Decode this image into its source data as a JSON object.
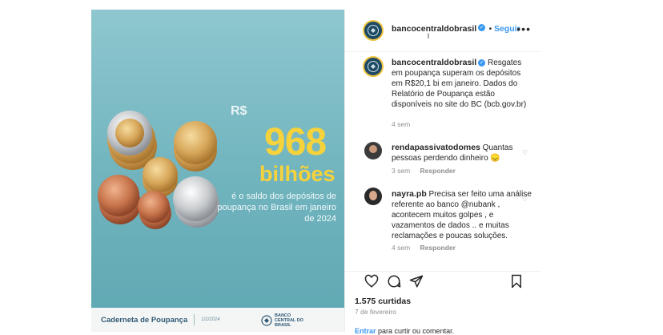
{
  "media": {
    "currency": "R$",
    "amount": "968",
    "unit": "bilhões",
    "description": "é o saldo dos depósitos de poupança no Brasil em janeiro de 2024",
    "footer_title": "Caderneta de Poupança",
    "footer_date": "1/2/2024",
    "footer_logo": "BANCO CENTRAL DO BRASIL"
  },
  "header": {
    "username": "bancocentraldobrasil",
    "subtitle": "l",
    "follow": "Seguir"
  },
  "caption": {
    "username": "bancocentraldobrasil",
    "text": "Resgates em poupança superam os depósitos em R$20,1 bi em janeiro. Dados do Relatório de Poupança estão disponíveis no site do BC (bcb.gov.br)",
    "time": "4 sem"
  },
  "comments": [
    {
      "username": "rendapassivatodomes",
      "text": "Quantas pessoas perdendo dinheiro 😞",
      "time": "3 sem",
      "reply": "Responder"
    },
    {
      "username": "nayra.pb",
      "text": "Precisa ser feito uma análise referente ao banco @nubank , acontecem muitos golpes , e vazamentos de dados .. e muitas reclamações e poucas soluções.",
      "time": "4 sem",
      "reply": "Responder"
    }
  ],
  "footer": {
    "likes": "1.575 curtidas",
    "date": "7 de fevereiro",
    "login_link": "Entrar",
    "login_rest": "para curtir ou comentar."
  },
  "colors": {
    "accent": "#3897f0",
    "highlight": "#f6d23b",
    "media_bg": "#7ebcc5"
  }
}
